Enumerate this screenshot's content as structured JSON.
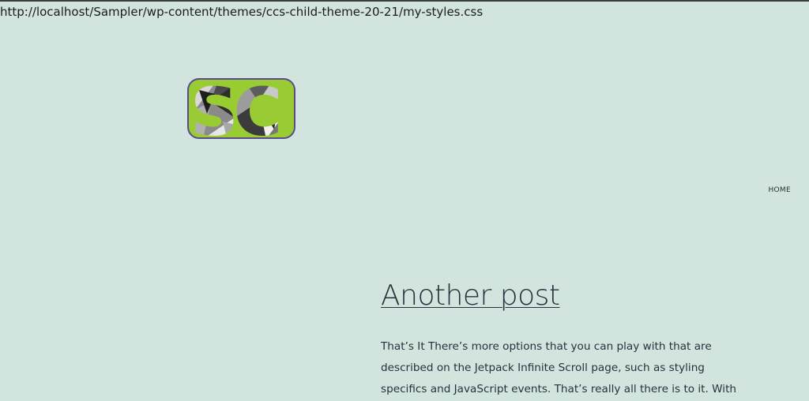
{
  "status_bar": {
    "url": "http://localhost/Sampler/wp-content/themes/ccs-child-theme-20-21/my-styles.css"
  },
  "site": {
    "logo_text": "SC",
    "logo_icon": "sc-logo-icon",
    "logo_colors": {
      "fill": "#99cc33",
      "border": "#5a4b8c"
    }
  },
  "nav": {
    "items": [
      {
        "label": "HOME"
      }
    ]
  },
  "post": {
    "title": "Another post",
    "excerpt": "That’s It There’s more options that you can play with that are described on the Jetpack Infinite Scroll page, such as styling specifics and JavaScript events. That’s really all there is to it. With"
  },
  "colors": {
    "background": "#d1e4dd",
    "text": "#28303d"
  }
}
